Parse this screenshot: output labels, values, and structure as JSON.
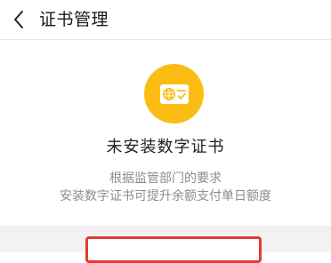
{
  "header": {
    "title": "证书管理",
    "back_icon": "chevron-left-icon"
  },
  "main": {
    "badge_icon": "globe-certificate-icon",
    "badge_color": "#fbbd14",
    "status_title": "未安装数字证书",
    "description_line1": "根据监管部门的要求",
    "description_line2": "安装数字证书可提升余额支付单日额度"
  },
  "footer": {
    "button_highlight_color": "#e53935"
  }
}
